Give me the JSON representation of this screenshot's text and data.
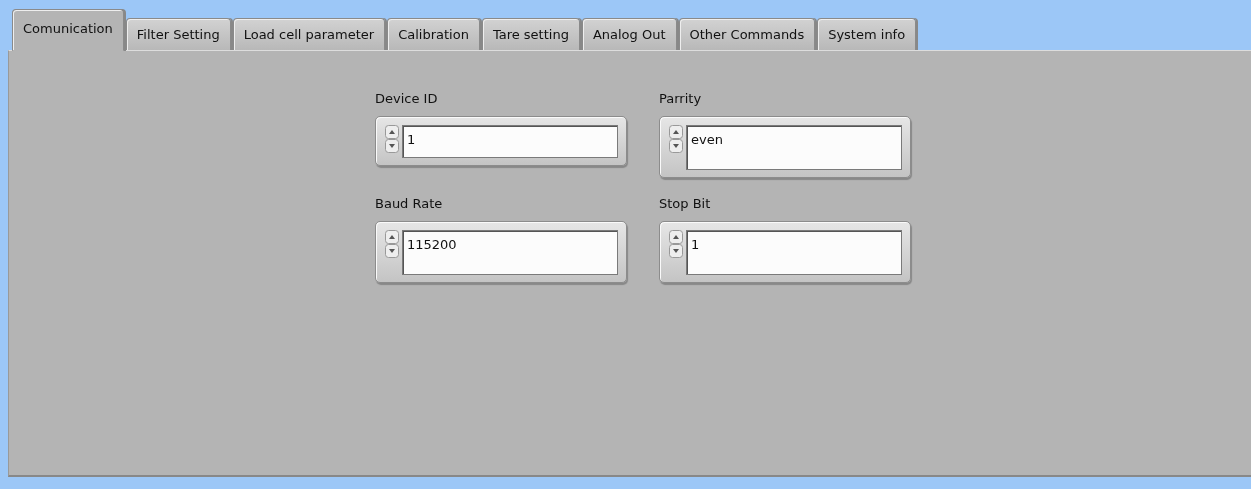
{
  "tabs": [
    {
      "label": "Comunication",
      "selected": true
    },
    {
      "label": "Filter Setting",
      "selected": false
    },
    {
      "label": "Load cell parameter",
      "selected": false
    },
    {
      "label": "Calibration",
      "selected": false
    },
    {
      "label": "Tare setting",
      "selected": false
    },
    {
      "label": "Analog Out",
      "selected": false
    },
    {
      "label": "Other Commands",
      "selected": false
    },
    {
      "label": "System info",
      "selected": false
    }
  ],
  "fields": [
    {
      "label": "Device ID",
      "value": "1"
    },
    {
      "label": "Parrity",
      "value": "even"
    },
    {
      "label": "Baud Rate",
      "value": "115200"
    },
    {
      "label": "Stop Bit",
      "value": "1"
    }
  ]
}
